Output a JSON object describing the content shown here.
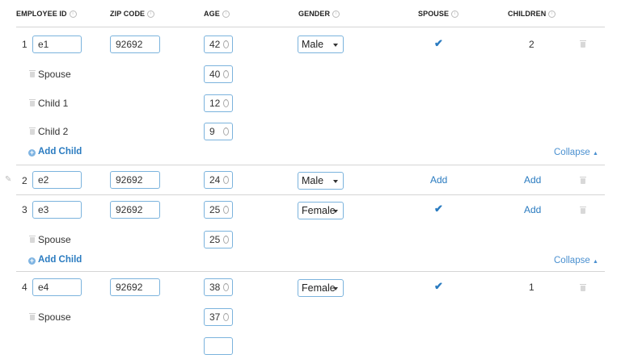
{
  "headers": {
    "employee_id": "EMPLOYEE ID",
    "zip": "ZIP CODE",
    "age": "AGE",
    "gender": "GENDER",
    "spouse": "SPOUSE",
    "children": "CHILDREN"
  },
  "labels": {
    "spouse": "Spouse",
    "child1": "Child 1",
    "child2": "Child 2",
    "add_child": "Add Child",
    "collapse": "Collapse",
    "add": "Add"
  },
  "icons": {
    "info": "info-icon",
    "trash": "trash-icon",
    "check": "check-icon",
    "pencil": "pencil-icon",
    "plus": "plus-circle-icon",
    "caret": "caret-down-icon"
  },
  "colors": {
    "accent": "#2a7bc0",
    "border": "#7bb3dd"
  },
  "employees": [
    {
      "num": "1",
      "id": "e1",
      "zip": "92692",
      "age": "42",
      "gender": "Male",
      "children_count": "2",
      "spouse_age": "40",
      "child_ages": [
        "12",
        "9"
      ]
    },
    {
      "num": "2",
      "id": "e2",
      "zip": "92692",
      "age": "24",
      "gender": "Male"
    },
    {
      "num": "3",
      "id": "e3",
      "zip": "92692",
      "age": "25",
      "gender": "Female",
      "spouse_age": "25"
    },
    {
      "num": "4",
      "id": "e4",
      "zip": "92692",
      "age": "38",
      "gender": "Female",
      "children_count": "1",
      "spouse_age": "37"
    }
  ]
}
